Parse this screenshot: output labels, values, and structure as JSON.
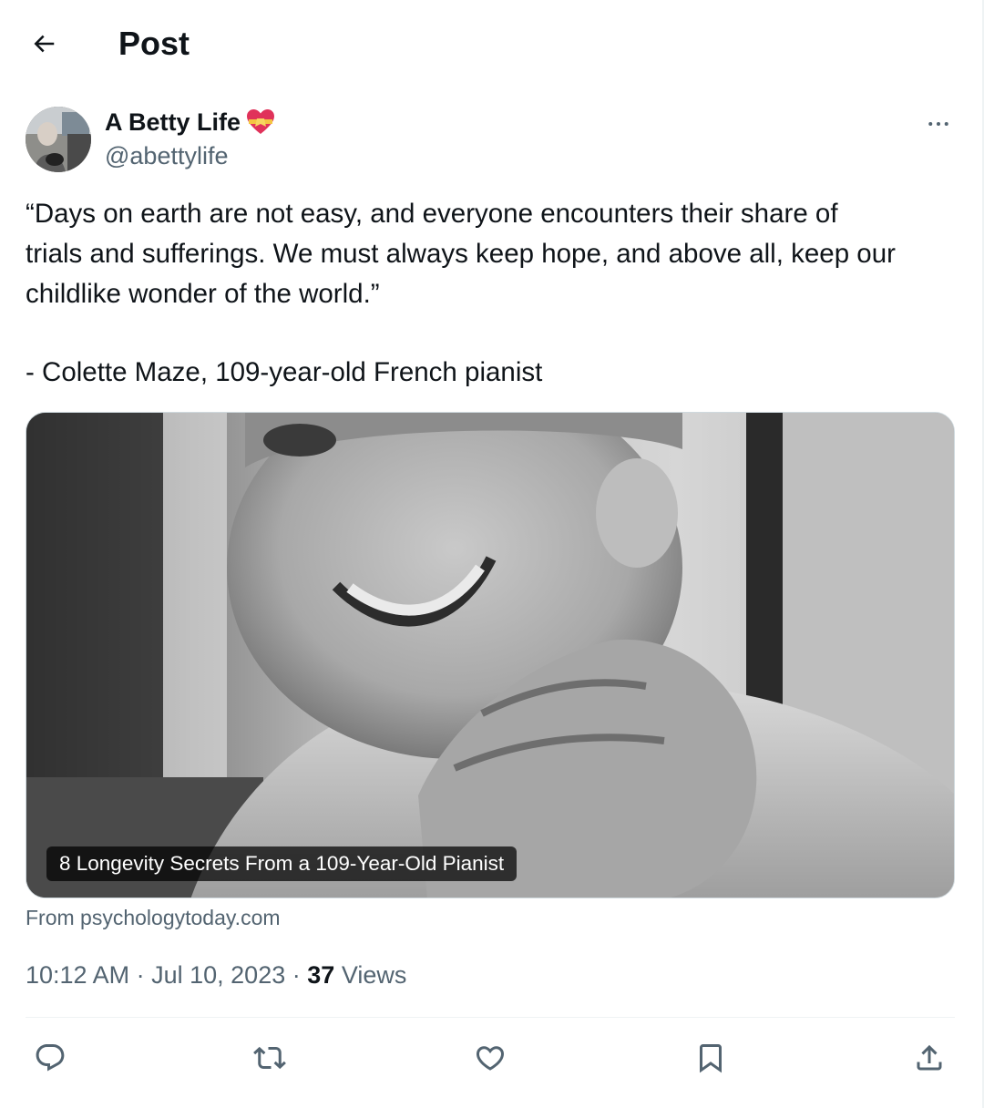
{
  "header": {
    "back_icon": "arrow-left-icon",
    "title": "Post"
  },
  "author": {
    "display_name": "A Betty Life",
    "name_emoji_icon": "heart-with-ribbon-icon",
    "handle": "@abettylife",
    "more_icon": "more-horizontal-icon"
  },
  "tweet": {
    "lines": [
      "“Days on earth are not easy, and everyone encounters their share of",
      "trials and sufferings. We must always keep hope, and above all, keep our",
      "childlike wonder of the world.”",
      "- Colette Maze, 109-year-old French pianist"
    ]
  },
  "card": {
    "caption": "8 Longevity Secrets From a 109-Year-Old Pianist",
    "source": "From psychologytoday.com"
  },
  "meta": {
    "time": "10:12 AM",
    "separator": "·",
    "date": "Jul 10, 2023",
    "views_count": "37",
    "views_label": "Views"
  },
  "actions": {
    "reply_icon": "reply-icon",
    "repost_icon": "repost-icon",
    "like_icon": "heart-icon",
    "bookmark_icon": "bookmark-icon",
    "share_icon": "share-icon"
  },
  "colors": {
    "text_primary": "#0f1419",
    "text_secondary": "#536471",
    "divider": "#eff3f4"
  }
}
